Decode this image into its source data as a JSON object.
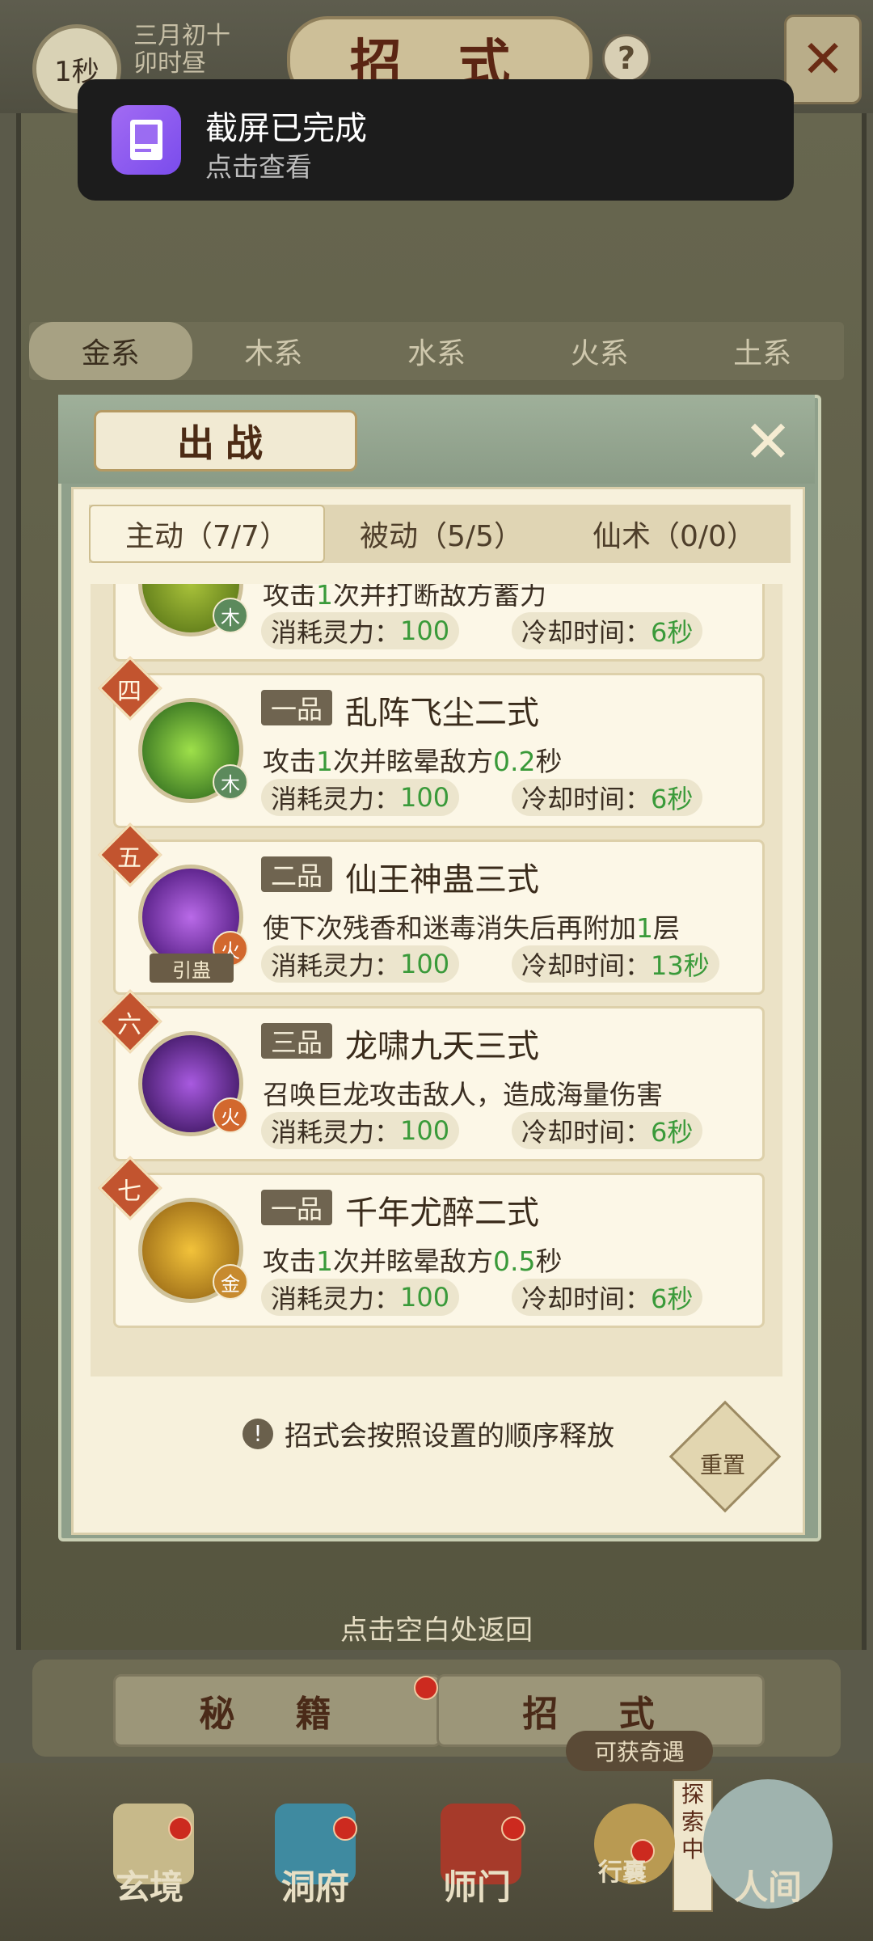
{
  "header": {
    "time": "1秒",
    "date_line1": "三月初十",
    "date_line2": "卯时昼",
    "title": "招 式",
    "help": "?",
    "close": "✕"
  },
  "toast": {
    "title": "截屏已完成",
    "subtitle": "点击查看"
  },
  "element_tabs": [
    "金系",
    "木系",
    "水系",
    "火系",
    "土系"
  ],
  "panel": {
    "title": "出战",
    "close": "✕",
    "sub_tabs": [
      "主动（7/7）",
      "被动（5/5）",
      "仙术（0/0）"
    ]
  },
  "skills": [
    {
      "rank": "",
      "grade": "",
      "name": "",
      "desc_a": "攻击",
      "desc_b": "1",
      "desc_c": "次并打断敌方蓄力",
      "element": "木",
      "cost_label": "消耗灵力：",
      "cost": "100",
      "cd_label": "冷却时间：",
      "cd": "6秒"
    },
    {
      "rank": "四",
      "grade": "一品",
      "name": "乱阵飞尘二式",
      "desc_a": "攻击",
      "desc_b": "1",
      "desc_c": "次并眩晕敌方",
      "desc_d": "0.2",
      "desc_e": "秒",
      "element": "木",
      "cost_label": "消耗灵力：",
      "cost": "100",
      "cd_label": "冷却时间：",
      "cd": "6秒"
    },
    {
      "rank": "五",
      "grade": "二品",
      "name": "仙王神蛊三式",
      "desc_a": "使下次残香和迷毒消失后再附加",
      "desc_b": "1",
      "desc_c": "层",
      "element": "火",
      "tag": "引蛊",
      "cost_label": "消耗灵力：",
      "cost": "100",
      "cd_label": "冷却时间：",
      "cd": "13秒"
    },
    {
      "rank": "六",
      "grade": "三品",
      "name": "龙啸九天三式",
      "desc_a": "召唤巨龙攻击敌人，造成海量伤害",
      "element": "火",
      "cost_label": "消耗灵力：",
      "cost": "100",
      "cd_label": "冷却时间：",
      "cd": "6秒"
    },
    {
      "rank": "七",
      "grade": "一品",
      "name": "千年尤醉二式",
      "desc_a": "攻击",
      "desc_b": "1",
      "desc_c": "次并眩晕敌方",
      "desc_d": "0.5",
      "desc_e": "秒",
      "element": "金",
      "cost_label": "消耗灵力：",
      "cost": "100",
      "cd_label": "冷却时间：",
      "cd": "6秒"
    }
  ],
  "hint": "招式会按照设置的顺序释放",
  "hint_icon": "!",
  "reset": "重置",
  "back_hint": "点击空白处返回",
  "bottom_tabs": [
    "秘 籍",
    "招 式"
  ],
  "reward": "可获奇遇",
  "explore": "探索中",
  "nav": [
    "玄境",
    "洞府",
    "师门",
    "行囊",
    "人间"
  ],
  "colors": {
    "green_value": "#3a9a3a",
    "rank_badge": "#c2542f",
    "toast_icon": "#8a5cf0"
  }
}
